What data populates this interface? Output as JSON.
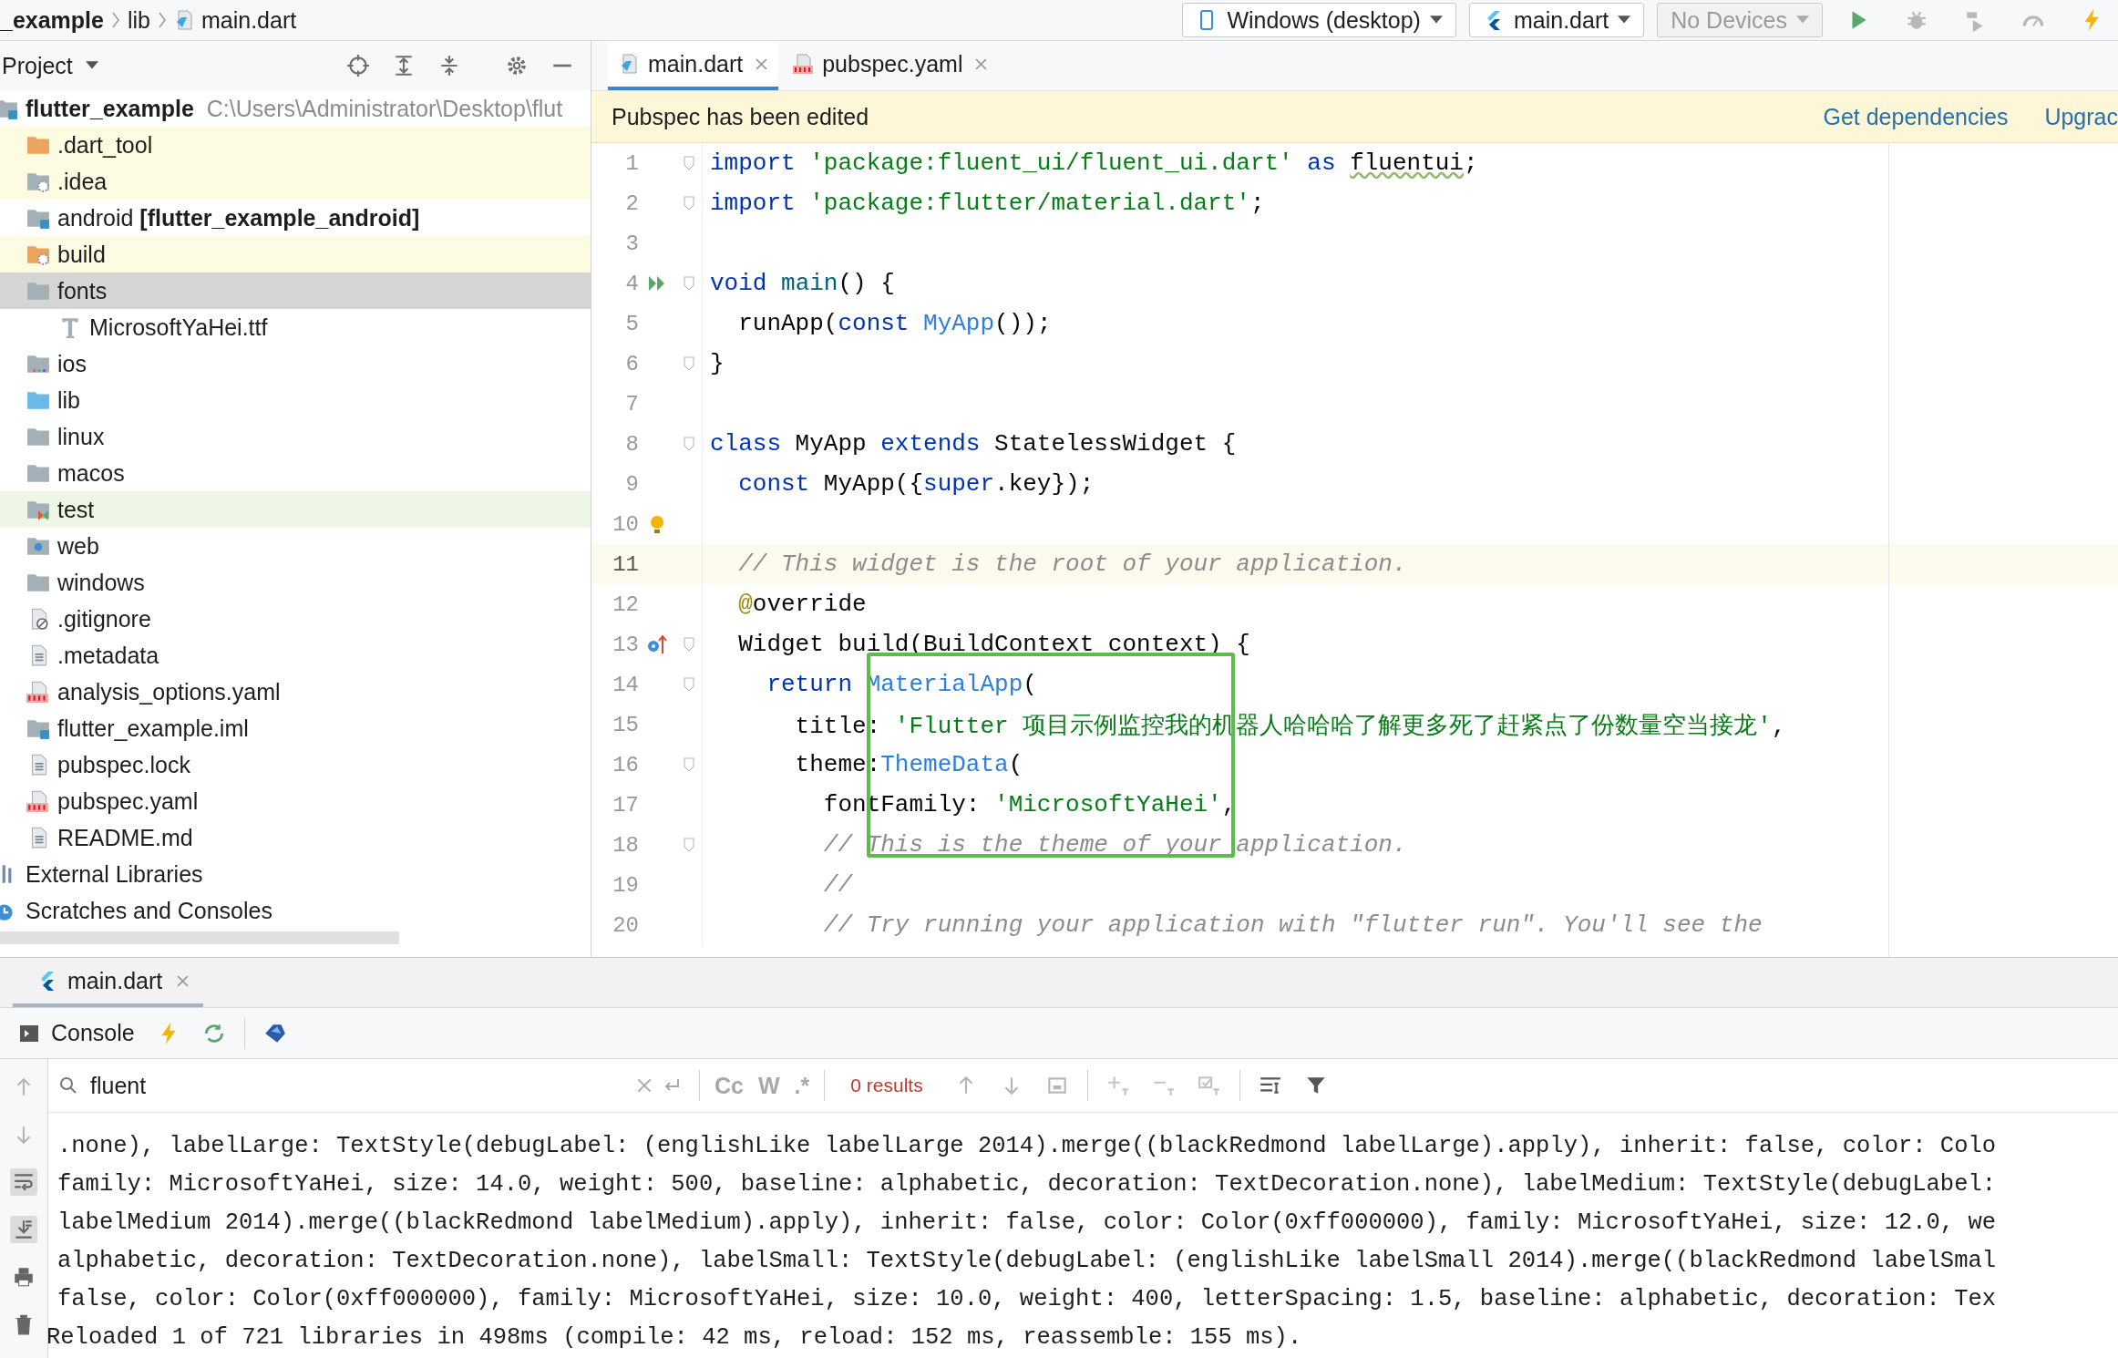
{
  "breadcrumbs": [
    {
      "label": "_example",
      "kind": "project"
    },
    {
      "label": "lib",
      "kind": "folder"
    },
    {
      "label": "main.dart",
      "kind": "dart-file"
    }
  ],
  "run_toolbar": {
    "device": "Windows (desktop)",
    "config": "main.dart",
    "target": {
      "label": "No Devices",
      "disabled": true
    }
  },
  "project_panel": {
    "title": "Project",
    "tree": [
      {
        "label": "flutter_example",
        "path": "C:\\Users\\Administrator\\Desktop\\flut",
        "kind": "module",
        "selected": false,
        "children": [
          {
            "label": ".dart_tool",
            "kind": "folder-excluded",
            "selected": false
          },
          {
            "label": ".idea",
            "kind": "folder-config",
            "selected": false
          },
          {
            "label": "android **[flutter_example_android]**",
            "kind": "folder-module",
            "selected": false
          },
          {
            "label": "build",
            "kind": "folder-excluded-config",
            "selected": false
          },
          {
            "label": "fonts",
            "kind": "folder",
            "selected": true,
            "children": [
              {
                "label": "MicrosoftYaHei.ttf",
                "kind": "font-file",
                "selected": false
              }
            ]
          },
          {
            "label": "ios",
            "kind": "folder-ios",
            "selected": false
          },
          {
            "label": "lib",
            "kind": "folder-source",
            "selected": false
          },
          {
            "label": "linux",
            "kind": "folder",
            "selected": false
          },
          {
            "label": "macos",
            "kind": "folder",
            "selected": false
          },
          {
            "label": "test",
            "kind": "folder-test",
            "selected": false
          },
          {
            "label": "web",
            "kind": "folder-web",
            "selected": false
          },
          {
            "label": "windows",
            "kind": "folder",
            "selected": false
          },
          {
            "label": ".gitignore",
            "kind": "file-ignore",
            "selected": false
          },
          {
            "label": ".metadata",
            "kind": "file-text",
            "selected": false
          },
          {
            "label": "analysis_options.yaml",
            "kind": "file-yaml",
            "selected": false
          },
          {
            "label": "flutter_example.iml",
            "kind": "folder-module",
            "selected": false
          },
          {
            "label": "pubspec.lock",
            "kind": "file-text",
            "selected": false
          },
          {
            "label": "pubspec.yaml",
            "kind": "file-yaml",
            "selected": false
          },
          {
            "label": "README.md",
            "kind": "file-text",
            "selected": false
          }
        ]
      },
      {
        "label": "External Libraries",
        "kind": "libraries",
        "selected": false
      },
      {
        "label": "Scratches and Consoles",
        "kind": "scratches",
        "selected": false
      }
    ]
  },
  "editor": {
    "tabs": [
      {
        "label": "main.dart",
        "kind": "dart",
        "selected": true
      },
      {
        "label": "pubspec.yaml",
        "kind": "yaml",
        "selected": false
      }
    ],
    "notice": {
      "text": "Pubspec has been edited",
      "actions": [
        "Get dependencies",
        "Upgrac"
      ]
    },
    "lines": [
      {
        "number": "1",
        "fold": true,
        "current": false,
        "tokens": [
          {
            "kind": "kw",
            "text": "import"
          },
          {
            "kind": "str",
            "text": " 'package:fluent_ui/fluent_ui.dart'"
          },
          {
            "kind": "kw",
            "text": " as "
          },
          {
            "kind": "typo",
            "text": "fluentui"
          },
          {
            "kind": "plain",
            "text": ";"
          }
        ]
      },
      {
        "number": "2",
        "fold": true,
        "current": false,
        "tokens": [
          {
            "kind": "kw",
            "text": "import"
          },
          {
            "kind": "str",
            "text": " 'package:flutter/material.dart'"
          },
          {
            "kind": "plain",
            "text": ";"
          }
        ]
      },
      {
        "number": "3",
        "fold": false,
        "current": false
      },
      {
        "number": "4",
        "fold": true,
        "current": false,
        "kind": "run",
        "tokens": [
          {
            "kind": "kw",
            "text": "void"
          },
          {
            "kind": "fn",
            "text": " main"
          },
          {
            "kind": "plain",
            "text": "() {"
          }
        ]
      },
      {
        "number": "5",
        "fold": false,
        "current": false,
        "tokens": [
          {
            "kind": "plain",
            "text": "  runApp("
          },
          {
            "kind": "kw",
            "text": "const"
          },
          {
            "kind": "cls",
            "text": " MyApp"
          },
          {
            "kind": "plain",
            "text": "());"
          }
        ]
      },
      {
        "number": "6",
        "fold": true,
        "current": false,
        "tokens": [
          {
            "kind": "plain",
            "text": "}"
          }
        ]
      },
      {
        "number": "7",
        "fold": false,
        "current": false
      },
      {
        "number": "8",
        "fold": true,
        "current": false,
        "tokens": [
          {
            "kind": "kw",
            "text": "class"
          },
          {
            "kind": "plain",
            "text": " MyApp "
          },
          {
            "kind": "kw",
            "text": "extends"
          },
          {
            "kind": "plain",
            "text": " StatelessWidget {"
          }
        ]
      },
      {
        "number": "9",
        "fold": false,
        "current": false,
        "tokens": [
          {
            "kind": "kw",
            "text": "  const"
          },
          {
            "kind": "plain",
            "text": " MyApp({"
          },
          {
            "kind": "kw",
            "text": "super"
          },
          {
            "kind": "plain",
            "text": ".key});"
          }
        ]
      },
      {
        "number": "10",
        "fold": false,
        "current": false,
        "kind": "bulb"
      },
      {
        "number": "11",
        "fold": false,
        "current": true,
        "tokens": [
          {
            "kind": "cmt",
            "text": "  // This widget is the root of your application."
          }
        ]
      },
      {
        "number": "12",
        "fold": false,
        "current": false,
        "tokens": [
          {
            "kind": "ann",
            "text": "  @"
          },
          {
            "kind": "plain",
            "text": "override"
          }
        ]
      },
      {
        "number": "13",
        "fold": true,
        "current": false,
        "kind": "override",
        "tokens": [
          {
            "kind": "plain",
            "text": "  Widget build(BuildContext context) {"
          }
        ]
      },
      {
        "number": "14",
        "fold": true,
        "current": false,
        "tokens": [
          {
            "kind": "kw",
            "text": "    return"
          },
          {
            "kind": "cls",
            "text": " MaterialApp"
          },
          {
            "kind": "plain",
            "text": "("
          }
        ]
      },
      {
        "number": "15",
        "fold": false,
        "current": false,
        "tokens": [
          {
            "kind": "plain",
            "text": "      title: "
          },
          {
            "kind": "str",
            "text": "'Flutter 项目示例监控我的机器人哈哈哈了解更多死了赶紧点了份数量空当接龙'"
          },
          {
            "kind": "plain",
            "text": ","
          }
        ]
      },
      {
        "number": "16",
        "fold": true,
        "current": false,
        "tokens": [
          {
            "kind": "plain",
            "text": "      theme:"
          },
          {
            "kind": "cls",
            "text": "ThemeData"
          },
          {
            "kind": "plain",
            "text": "("
          }
        ]
      },
      {
        "number": "17",
        "fold": false,
        "current": false,
        "tokens": [
          {
            "kind": "plain",
            "text": "        fontFamily: "
          },
          {
            "kind": "str",
            "text": "'MicrosoftYaHei'"
          },
          {
            "kind": "plain",
            "text": ","
          }
        ]
      },
      {
        "number": "18",
        "fold": true,
        "current": false,
        "tokens": [
          {
            "kind": "cmt",
            "text": "        // This is the theme of your application."
          }
        ]
      },
      {
        "number": "19",
        "fold": false,
        "current": false,
        "tokens": [
          {
            "kind": "cmt",
            "text": "        //"
          }
        ]
      },
      {
        "number": "20",
        "fold": false,
        "current": false,
        "tokens": [
          {
            "kind": "cmt",
            "text": "        // Try running your application with \"flutter run\". You'll see the"
          }
        ]
      }
    ]
  },
  "run_panel": {
    "tabs": [
      {
        "label": "main.dart",
        "selected": true
      }
    ],
    "console_tab": "Console",
    "search": {
      "value": "fluent",
      "toggles": [
        "Cc",
        "W",
        ".*"
      ],
      "results": "0 results"
    },
    "output": [
      ".none), labelLarge: TextStyle(debugLabel: (englishLike labelLarge 2014).merge((blackRedmond labelLarge).apply), inherit: false, color: Colo",
      "family: MicrosoftYaHei, size: 14.0, weight: 500, baseline: alphabetic, decoration: TextDecoration.none), labelMedium: TextStyle(debugLabel:",
      "labelMedium 2014).merge((blackRedmond labelMedium).apply), inherit: false, color: Color(0xff000000), family: MicrosoftYaHei, size: 12.0, we",
      "alphabetic, decoration: TextDecoration.none), labelSmall: TextStyle(debugLabel: (englishLike labelSmall 2014).merge((blackRedmond labelSmal",
      "false, color: Color(0xff000000), family: MicrosoftYaHei, size: 10.0, weight: 400, letterSpacing: 1.5, baseline: alphabetic, decoration: Tex",
      "Reloaded 1 of 721 libraries in 498ms (compile: 42 ms, reload: 152 ms, reassemble: 155 ms)."
    ]
  }
}
